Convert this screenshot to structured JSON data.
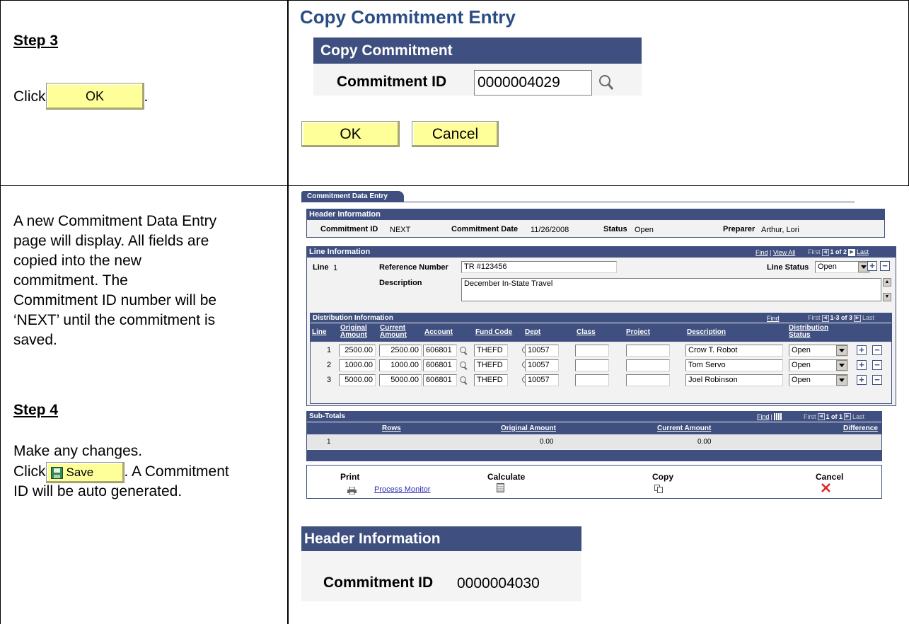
{
  "row1": {
    "step_label": "Step 3",
    "click_text": "Click",
    "ok_inline_label": "OK",
    "period": ".",
    "page_title": "Copy Commitment Entry",
    "section_header": "Copy Commitment",
    "commitment_id_label": "Commitment ID",
    "commitment_id_value": "0000004029",
    "ok_label": "OK",
    "cancel_label": "Cancel"
  },
  "row2": {
    "description_lines": [
      "A new Commitment Data Entry",
      "page will display.  All fields are",
      "copied into the new",
      "commitment.  The",
      "Commitment ID number will be",
      "‘NEXT’ until the commitment is",
      "saved."
    ],
    "step_label": "Step 4",
    "make_changes": "Make any changes.",
    "click_text": "Click",
    "save_label": "Save",
    "after_save": ". A Commitment",
    "auto_gen": "ID will be auto generated."
  },
  "screen": {
    "tab_label": "Commitment Data Entry",
    "header": {
      "title": "Header Information",
      "commitment_id_label": "Commitment ID",
      "commitment_id_value": "NEXT",
      "commitment_date_label": "Commitment Date",
      "commitment_date_value": "11/26/2008",
      "status_label": "Status",
      "status_value": "Open",
      "preparer_label": "Preparer",
      "preparer_value": "Arthur, Lori"
    },
    "line_info": {
      "title": "Line Information",
      "find": "Find",
      "sep": "|",
      "view_all": "View All",
      "first": "First",
      "counter": "1 of 2",
      "last": "Last",
      "line_label": "Line",
      "line_value": "1",
      "ref_label": "Reference Number",
      "ref_value": "TR #123456",
      "line_status_label": "Line Status",
      "line_status_value": "Open",
      "desc_label": "Description",
      "desc_value": "December In-State Travel"
    },
    "dist": {
      "title": "Distribution Information",
      "find": "Find",
      "first": "First",
      "counter": "1-3 of 3",
      "last": "Last",
      "headers": {
        "line": "Line",
        "orig1": "Original",
        "orig2": "Amount",
        "cur1": "Current",
        "cur2": "Amount",
        "account": "Account",
        "fund": "Fund Code",
        "dept": "Dept",
        "class": "Class",
        "project": "Project",
        "description": "Description",
        "ds1": "Distribution",
        "ds2": "Status"
      },
      "rows": [
        {
          "line": "1",
          "orig": "2500.00",
          "cur": "2500.00",
          "account": "606801",
          "fund": "THEFD",
          "dept": "10057",
          "class": "",
          "project": "",
          "desc": "Crow T. Robot",
          "status": "Open"
        },
        {
          "line": "2",
          "orig": "1000.00",
          "cur": "1000.00",
          "account": "606801",
          "fund": "THEFD",
          "dept": "10057",
          "class": "",
          "project": "",
          "desc": "Tom Servo",
          "status": "Open"
        },
        {
          "line": "3",
          "orig": "5000.00",
          "cur": "5000.00",
          "account": "606801",
          "fund": "THEFD",
          "dept": "10057",
          "class": "",
          "project": "",
          "desc": "Joel Robinson",
          "status": "Open"
        }
      ]
    },
    "subtotals": {
      "title": "Sub-Totals",
      "find": "Find",
      "sep": "|",
      "first": "First",
      "counter": "1 of 1",
      "last": "Last",
      "col_rows": "Rows",
      "col_orig": "Original Amount",
      "col_cur": "Current Amount",
      "col_diff": "Difference",
      "row_num": "1",
      "orig": "0.00",
      "cur": "0.00"
    },
    "actions": {
      "print": "Print",
      "process_monitor": "Process Monitor",
      "calculate": "Calculate",
      "copy": "Copy",
      "cancel": "Cancel"
    }
  },
  "result": {
    "title": "Header Information",
    "commitment_id_label": "Commitment ID",
    "commitment_id_value": "0000004030"
  }
}
